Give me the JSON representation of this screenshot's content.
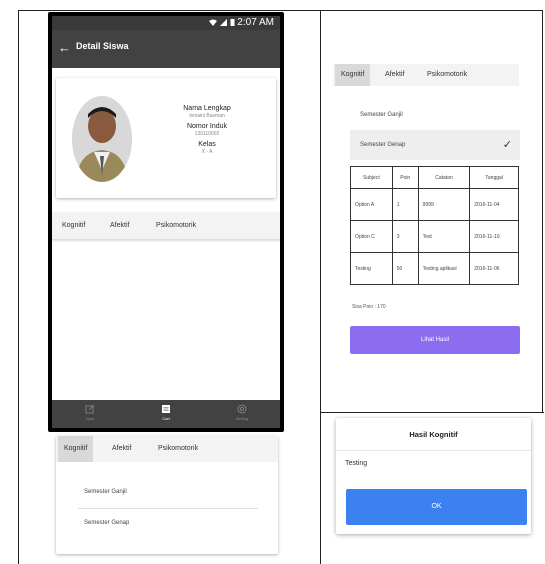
{
  "status_bar": {
    "time": "2:07 AM"
  },
  "app_bar": {
    "title": "Detail Siswa"
  },
  "profile": {
    "name_label": "Nama Lengkap",
    "name_value": "Ismaini Basman",
    "id_label": "Nomor Induk",
    "id_value": "130110002",
    "class_label": "Kelas",
    "class_value": "X - A"
  },
  "tabs": [
    "Kognitif",
    "Afektif",
    "Psikomotorik"
  ],
  "bottom_nav": [
    {
      "label": "Input",
      "icon": "edit-icon"
    },
    {
      "label": "Cari",
      "icon": "list-icon"
    },
    {
      "label": "Setting",
      "icon": "settings-icon"
    }
  ],
  "semesters": {
    "ganjil": "Semester Ganjil",
    "genap": "Semester Genap",
    "check_glyph": "✓"
  },
  "grade_table": {
    "headers": [
      "Subject",
      "Poin",
      "Catatan",
      "Tanggal"
    ],
    "rows": [
      [
        "Option A",
        "1",
        "9999",
        "2016-11-04"
      ],
      [
        "Option C",
        "3",
        "Test",
        "2016-11-10"
      ],
      [
        "Testing",
        "50",
        "Testing aplikasi",
        "2016-11-06"
      ]
    ]
  },
  "sisa_poin": "Sisa Poin : 170",
  "lihat_hasil": "Lihat Hasil",
  "dialog": {
    "title": "Hasil Kognitif",
    "message": "Testing",
    "ok": "OK"
  },
  "colors": {
    "app_bar": "#424242",
    "purple_button": "#8c6df0",
    "ok_button": "#3b82f0"
  }
}
